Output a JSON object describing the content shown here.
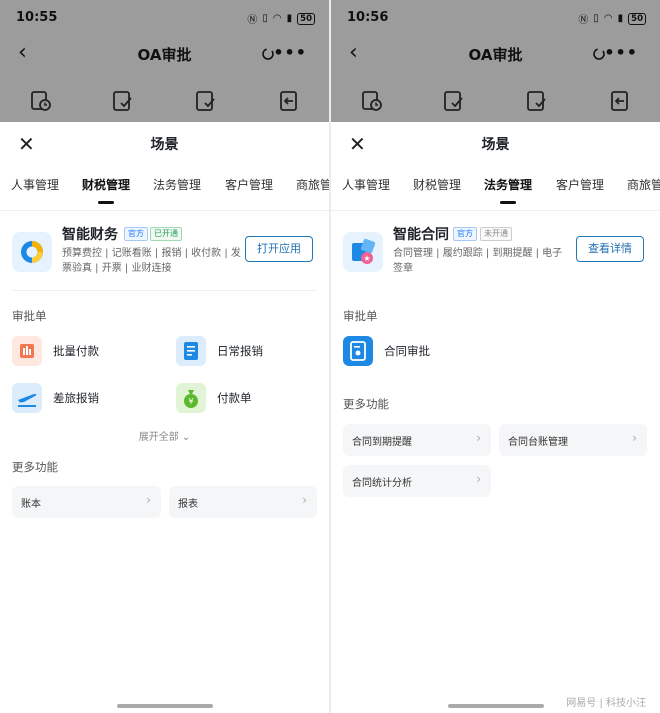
{
  "screens": [
    {
      "status": {
        "time": "10:55",
        "battery": "50"
      },
      "nav": {
        "title": "OA审批"
      },
      "sheet_title": "场景",
      "tabs": [
        "人事管理",
        "财税管理",
        "法务管理",
        "客户管理",
        "商旅管"
      ],
      "active_tab": 1,
      "app": {
        "name": "智能财务",
        "badge1": "官方",
        "badge2": "已开通",
        "desc_line1": "预算费控 | 记账看账 | 报销 | 收付款 | 发",
        "desc_line2": "票验真 | 开票 | 业财连接",
        "button": "打开应用"
      },
      "approval_title": "审批单",
      "approval_items": [
        "批量付款",
        "日常报销",
        "差旅报销",
        "付款单"
      ],
      "expand_label": "展开全部",
      "more_title": "更多功能",
      "more_items": [
        "账本",
        "报表"
      ]
    },
    {
      "status": {
        "time": "10:56",
        "battery": "50"
      },
      "nav": {
        "title": "OA审批"
      },
      "sheet_title": "场景",
      "tabs": [
        "人事管理",
        "财税管理",
        "法务管理",
        "客户管理",
        "商旅管"
      ],
      "active_tab": 2,
      "app": {
        "name": "智能合同",
        "badge1": "官方",
        "badge2": "未开通",
        "desc_line1": "合同管理 | 履约跟踪 | 到期提醒 | 电子",
        "desc_line2": "签章",
        "button": "查看详情"
      },
      "approval_title": "审批单",
      "approval_items": [
        "合同审批"
      ],
      "more_title": "更多功能",
      "more_items": [
        "合同到期提醒",
        "合同台账管理",
        "合同统计分析"
      ]
    }
  ],
  "watermark": "网易号 | 科技小汪"
}
